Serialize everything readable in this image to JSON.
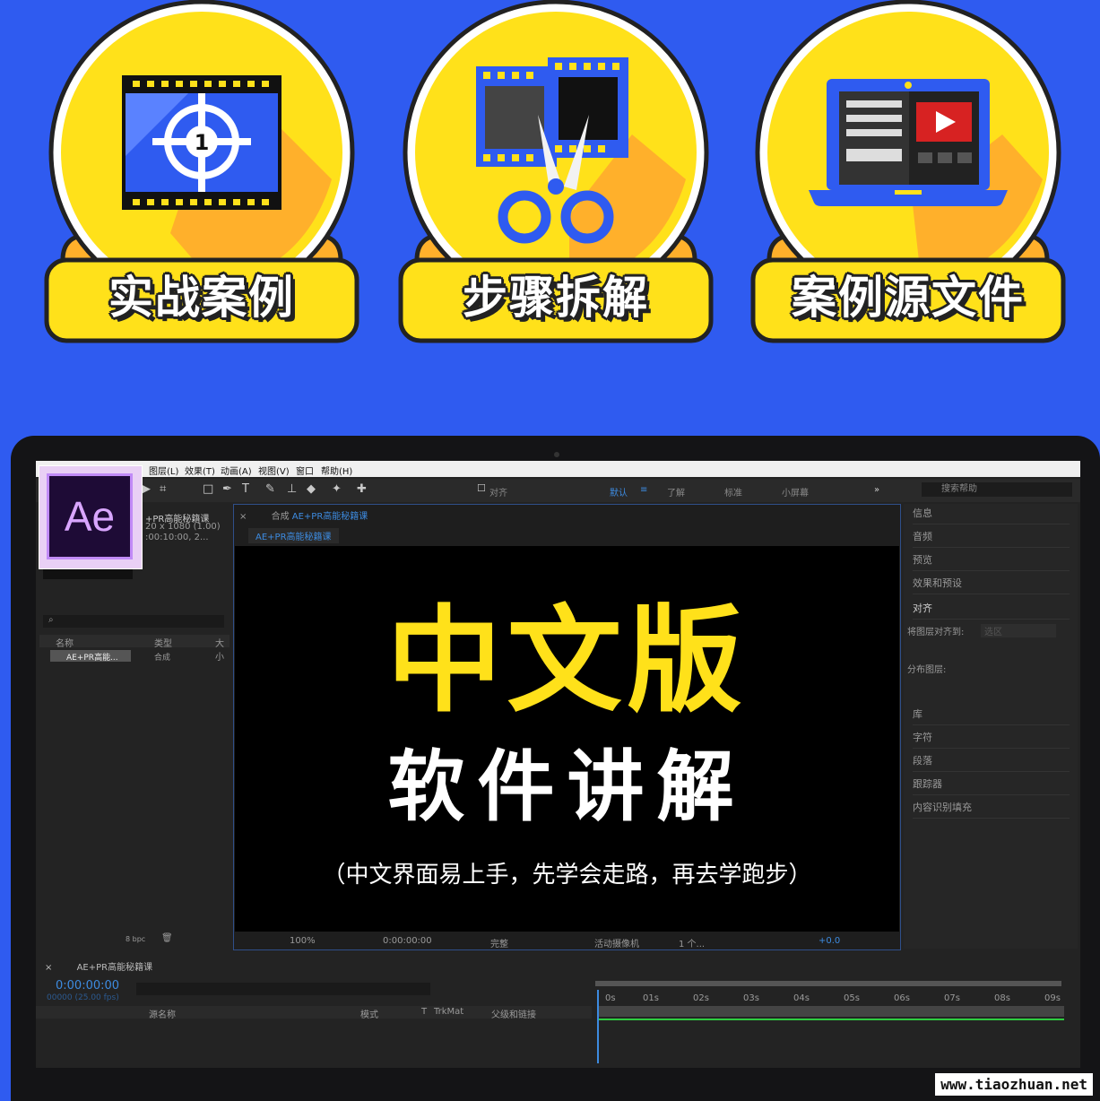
{
  "badges": [
    {
      "label": "实战案例",
      "icon": "film-countdown-icon"
    },
    {
      "label": "步骤拆解",
      "icon": "film-scissors-icon"
    },
    {
      "label": "案例源文件",
      "icon": "laptop-video-icon"
    }
  ],
  "menu": {
    "items": [
      "图层(L)",
      "效果(T)",
      "动画(A)",
      "视图(V)",
      "窗口",
      "帮助(H)"
    ]
  },
  "toolbar": {
    "align_label": "对齐",
    "workspaces": [
      "默认",
      "了解",
      "标准",
      "小屏幕"
    ],
    "search_placeholder": "搜索帮助"
  },
  "app_logo": "Ae",
  "project": {
    "comp_name": "+PR高能秘籍课",
    "comp_dims": "20 x 1080 (1.00)",
    "comp_duration": ":00:10:00, 2...",
    "columns": [
      "名称",
      "类型",
      "大小"
    ],
    "row": {
      "name": "AE+PR高能...",
      "type": "合成"
    },
    "bpc": "8 bpc"
  },
  "composition": {
    "tab_prefix": "合成",
    "tab_name": "AE+PR高能秘籍课",
    "sub_tab": "AE+PR高能秘籍课",
    "zoom": "100%",
    "timecode": "0:00:00:00",
    "resolution": "完整",
    "camera": "活动摄像机",
    "views": "1 个...",
    "exposure": "+0.0"
  },
  "overlay": {
    "title": "中文版",
    "subtitle": "软件讲解",
    "note": "（中文界面易上手，先学会走路，再去学跑步）"
  },
  "right_panels": {
    "items_top": [
      "信息",
      "音频",
      "预览",
      "效果和预设",
      "对齐"
    ],
    "align_to_label": "将图层对齐到:",
    "align_to_value": "选区",
    "distribute_label": "分布图层:",
    "items_bottom": [
      "库",
      "字符",
      "段落",
      "跟踪器",
      "内容识别填充"
    ]
  },
  "timeline": {
    "tab_name": "AE+PR高能秘籍课",
    "timecode": "0:00:00:00",
    "fps": "00000 (25.00 fps)",
    "columns": [
      "源名称",
      "模式",
      "T",
      "TrkMat",
      "父级和链接"
    ],
    "ruler": [
      "0s",
      "01s",
      "02s",
      "03s",
      "04s",
      "05s",
      "06s",
      "07s",
      "08s",
      "09s"
    ]
  },
  "watermark": "www.tiaozhuan.net",
  "colors": {
    "background": "#2f5bf0",
    "badge_yellow": "#ffe11a",
    "headline_yellow": "#ffe11a",
    "ae_purple": "#1e0b36",
    "ae_accent": "#c18bf7",
    "timeline_blue": "#3d8be0"
  }
}
